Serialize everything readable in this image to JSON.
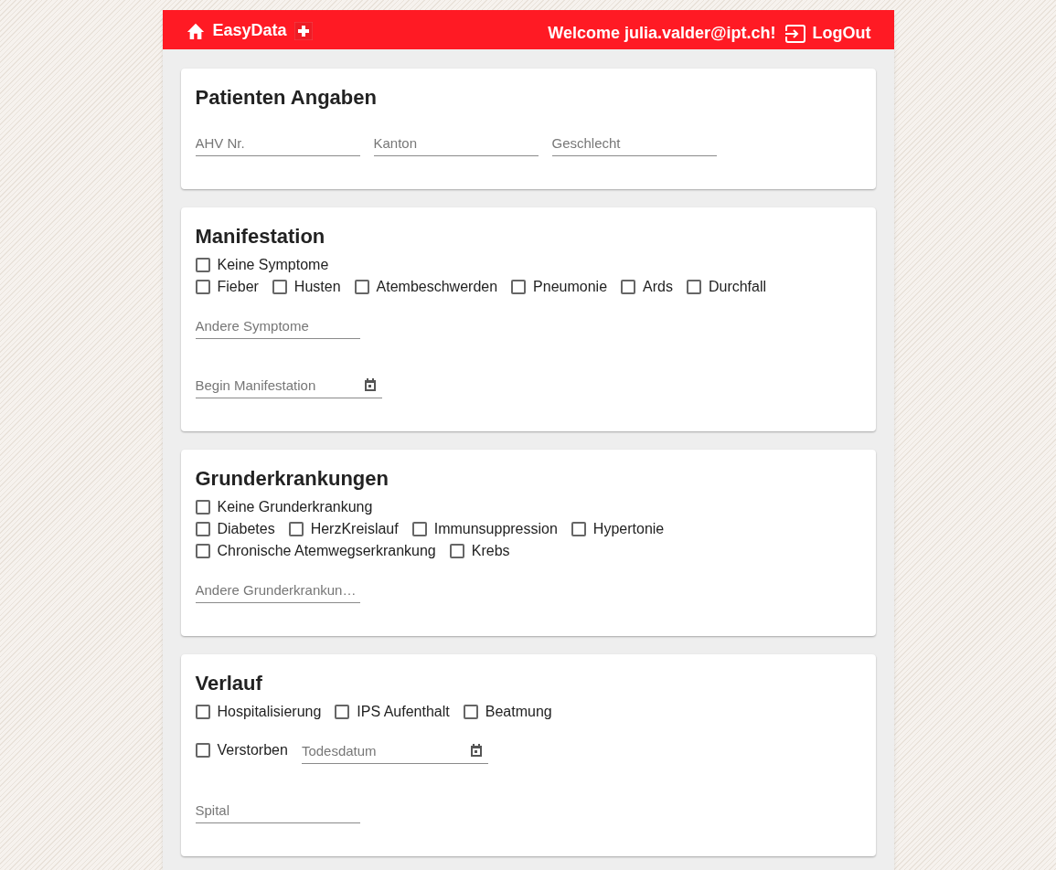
{
  "header": {
    "brand": "EasyData",
    "welcome": "Welcome julia.valder@ipt.ch!",
    "logout": "LogOut"
  },
  "sections": [
    {
      "title": "Patienten Angaben",
      "lines": [
        {
          "items": [
            {
              "kind": "text",
              "placeholder": "AHV Nr."
            },
            {
              "kind": "text",
              "placeholder": "Kanton"
            },
            {
              "kind": "text",
              "placeholder": "Geschlecht"
            }
          ]
        }
      ]
    },
    {
      "title": "Manifestation",
      "lines": [
        {
          "items": [
            {
              "kind": "checkbox",
              "label": "Keine Symptome",
              "checked": false
            }
          ]
        },
        {
          "items": [
            {
              "kind": "checkbox",
              "label": "Fieber",
              "checked": false
            },
            {
              "kind": "checkbox",
              "label": "Husten",
              "checked": false
            },
            {
              "kind": "checkbox",
              "label": "Atembeschwerden",
              "checked": false
            },
            {
              "kind": "checkbox",
              "label": "Pneumonie",
              "checked": false
            },
            {
              "kind": "checkbox",
              "label": "Ards",
              "checked": false
            },
            {
              "kind": "checkbox",
              "label": "Durchfall",
              "checked": false
            }
          ]
        },
        {
          "items": [
            {
              "kind": "text",
              "placeholder": "Andere Symptome"
            }
          ]
        },
        {
          "items": [
            {
              "kind": "date",
              "placeholder": "Begin Manifestation"
            }
          ]
        }
      ]
    },
    {
      "title": "Grunderkrankungen",
      "lines": [
        {
          "items": [
            {
              "kind": "checkbox",
              "label": "Keine Grunderkrankung",
              "checked": false
            }
          ]
        },
        {
          "items": [
            {
              "kind": "checkbox",
              "label": "Diabetes",
              "checked": false
            },
            {
              "kind": "checkbox",
              "label": "HerzKreislauf",
              "checked": false
            },
            {
              "kind": "checkbox",
              "label": "Immunsuppression",
              "checked": false
            },
            {
              "kind": "checkbox",
              "label": "Hypertonie",
              "checked": false
            }
          ]
        },
        {
          "items": [
            {
              "kind": "checkbox",
              "label": "Chronische Atemwegserkrankung",
              "checked": false
            },
            {
              "kind": "checkbox",
              "label": "Krebs",
              "checked": false
            }
          ]
        },
        {
          "items": [
            {
              "kind": "text",
              "placeholder": "Andere Grunderkrankun…"
            }
          ]
        }
      ]
    },
    {
      "title": "Verlauf",
      "lines": [
        {
          "items": [
            {
              "kind": "checkbox",
              "label": "Hospitalisierung",
              "checked": false
            },
            {
              "kind": "checkbox",
              "label": "IPS Aufenthalt",
              "checked": false
            },
            {
              "kind": "checkbox",
              "label": "Beatmung",
              "checked": false
            }
          ]
        },
        {
          "items": [
            {
              "kind": "checkbox",
              "label": "Verstorben",
              "checked": false
            },
            {
              "kind": "date",
              "placeholder": "Todesdatum"
            }
          ]
        },
        {
          "items": [
            {
              "kind": "text",
              "placeholder": "Spital"
            }
          ]
        }
      ]
    }
  ]
}
